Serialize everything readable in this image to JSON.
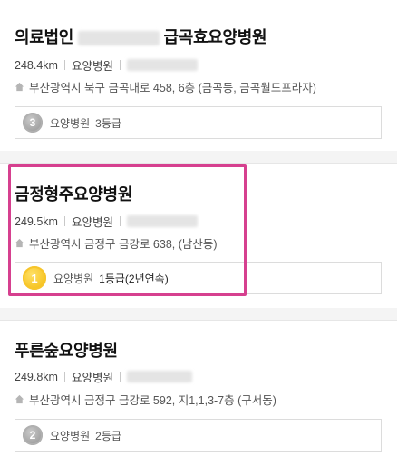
{
  "results": [
    {
      "name": "의료법인",
      "name_suffix": "급곡효요양병원",
      "distance": "248.4km",
      "type": "요양병원",
      "address": "부산광역시 북구 금곡대로 458, 6층 (금곡동, 금곡월드프라자)",
      "grade_type": "요양병원",
      "grade": "3등급",
      "medal_number": "3",
      "medal_color": "silver"
    },
    {
      "name": "금정형주요양병원",
      "distance": "249.5km",
      "type": "요양병원",
      "address": "부산광역시 금정구 금강로 638, (남산동)",
      "grade_type": "요양병원",
      "grade": "1등급(2년연속)",
      "medal_number": "1",
      "medal_color": "gold"
    },
    {
      "name": "푸른숲요양병원",
      "distance": "249.8km",
      "type": "요양병원",
      "address": "부산광역시 금정구 금강로 592, 지1,1,3-7층 (구서동)",
      "grade_type": "요양병원",
      "grade": "2등급",
      "medal_number": "2",
      "medal_color": "silver"
    }
  ],
  "colors": {
    "highlight": "#d6408f",
    "gold": "#f2b705",
    "silver": "#9a9a9a"
  }
}
